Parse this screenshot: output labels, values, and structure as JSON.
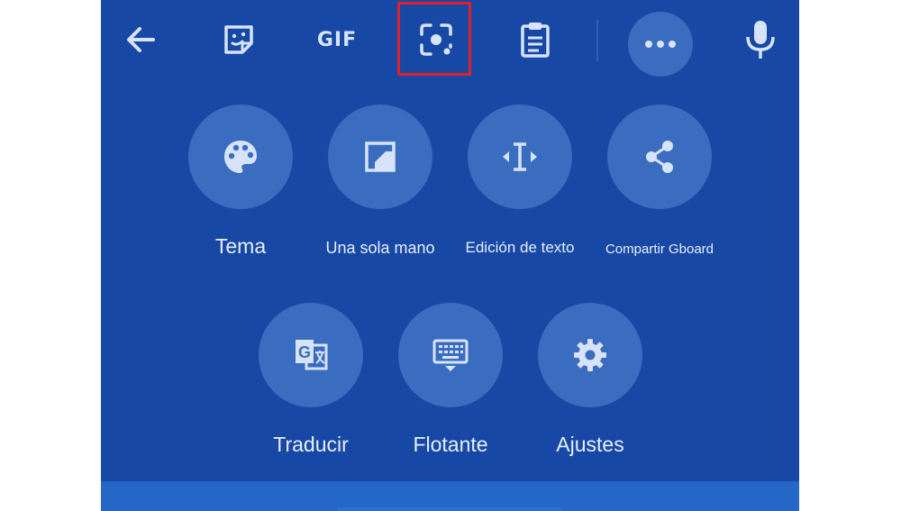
{
  "colors": {
    "panel_bg": "#1748a6",
    "circle_bg": "#3a6cc0",
    "icon": "#d7e3f8",
    "highlight_border": "#e0202a",
    "bottom_strip": "#2567c6"
  },
  "toolbar": {
    "back_icon": "arrow-left-icon",
    "sticker_icon": "sticker-icon",
    "gif_label": "GIF",
    "lens_icon": "lens-scan-icon",
    "clipboard_icon": "clipboard-icon",
    "more_icon": "more-horizontal-icon",
    "mic_icon": "microphone-icon"
  },
  "grid": {
    "row1": [
      {
        "label": "Tema",
        "icon": "palette-icon"
      },
      {
        "label": "Una sola mano",
        "icon": "one-handed-icon"
      },
      {
        "label": "Edición de texto",
        "icon": "text-cursor-icon"
      },
      {
        "label": "Compartir Gboard",
        "icon": "share-icon"
      }
    ],
    "row2": [
      {
        "label": "Traducir",
        "icon": "translate-icon"
      },
      {
        "label": "Flotante",
        "icon": "floating-keyboard-icon"
      },
      {
        "label": "Ajustes",
        "icon": "gear-icon"
      }
    ]
  }
}
